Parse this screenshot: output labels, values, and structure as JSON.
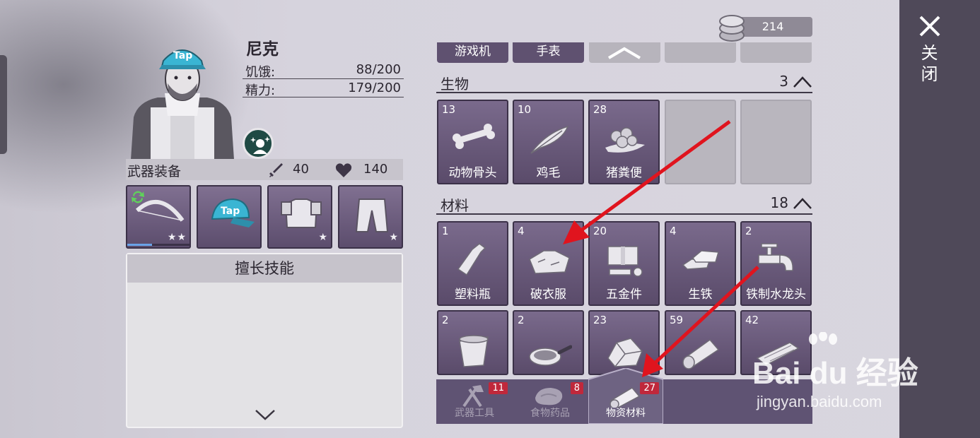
{
  "character": {
    "name": "尼克",
    "hunger_label": "饥饿:",
    "hunger_value": "88/200",
    "energy_label": "精力:",
    "energy_value": "179/200"
  },
  "weapon_bar": {
    "title": "武器装备",
    "attack": "40",
    "health": "140"
  },
  "equipment": [
    {
      "name": "bow",
      "stars": "★★",
      "durability": 0.4
    },
    {
      "name": "tap-cap",
      "stars": ""
    },
    {
      "name": "armor-vest",
      "stars": "★"
    },
    {
      "name": "pants",
      "stars": "★"
    }
  ],
  "skills": {
    "title": "擅长技能"
  },
  "currency": {
    "value": "214"
  },
  "top_tabs": [
    "游戏机",
    "手表"
  ],
  "categories": [
    {
      "name": "生物",
      "count": "3",
      "items": [
        {
          "qty": "13",
          "name": "动物骨头",
          "icon": "bone-icon"
        },
        {
          "qty": "10",
          "name": "鸡毛",
          "icon": "feather-icon"
        },
        {
          "qty": "28",
          "name": "猪粪便",
          "icon": "manure-icon"
        }
      ]
    },
    {
      "name": "材料",
      "count": "18",
      "items": [
        {
          "qty": "1",
          "name": "塑料瓶",
          "icon": "bottle-icon"
        },
        {
          "qty": "4",
          "name": "破衣服",
          "icon": "clothes-icon"
        },
        {
          "qty": "20",
          "name": "五金件",
          "icon": "hardware-icon"
        },
        {
          "qty": "4",
          "name": "生铁",
          "icon": "iron-icon"
        },
        {
          "qty": "2",
          "name": "铁制水龙头",
          "icon": "faucet-icon"
        },
        {
          "qty": "2",
          "name": "",
          "icon": "bucket-icon"
        },
        {
          "qty": "2",
          "name": "",
          "icon": "pan-icon"
        },
        {
          "qty": "23",
          "name": "",
          "icon": "ore-icon"
        },
        {
          "qty": "59",
          "name": "",
          "icon": "log-icon"
        },
        {
          "qty": "42",
          "name": "",
          "icon": "plank-icon"
        }
      ]
    }
  ],
  "bottom_tabs": [
    {
      "label": "武器工具",
      "count": "11"
    },
    {
      "label": "食物药品",
      "count": "8"
    },
    {
      "label": "物资材料",
      "count": "27"
    }
  ],
  "close": {
    "label": "关闭"
  },
  "watermark": {
    "brand": "Bai du 经验",
    "url": "jingyan.baidu.com"
  },
  "colors": {
    "tile": "#6a5a7c",
    "badge_red": "#c0283b",
    "arrow_red": "#e0141e",
    "panel": "#4f4959"
  }
}
